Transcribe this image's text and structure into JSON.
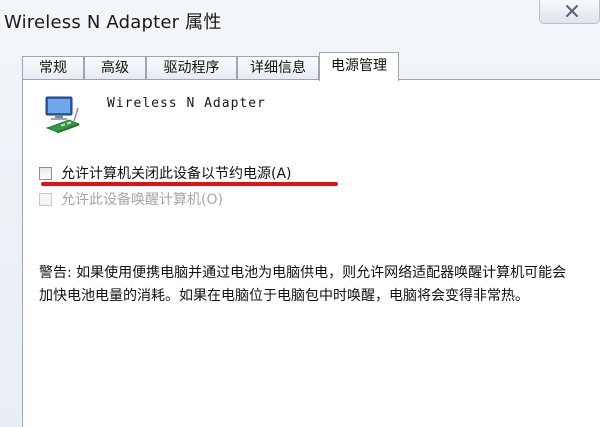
{
  "window": {
    "title": "Wireless N Adapter 属性"
  },
  "tabs": [
    {
      "label": "常规"
    },
    {
      "label": "高级"
    },
    {
      "label": "驱动程序"
    },
    {
      "label": "详细信息"
    },
    {
      "label": "电源管理",
      "active": true
    }
  ],
  "panel": {
    "device_name": "Wireless N Adapter",
    "device_icon": "network-adapter-icon",
    "options": [
      {
        "label": "允许计算机关闭此设备以节约电源(A)",
        "checked": false,
        "enabled": true
      },
      {
        "label": "允许此设备唤醒计算机(O)",
        "checked": false,
        "enabled": false
      }
    ],
    "warning": "警告: 如果使用便携电脑并通过电池为电脑供电，则允许网络适配器唤醒计算机可能会加快电池电量的消耗。如果在电脑位于电脑包中时唤醒，电脑将会变得非常热。"
  },
  "colors": {
    "highlight_underline": "#e0101a",
    "tab_border": "#9aa6b4",
    "disabled_text": "#a6a6a6"
  }
}
